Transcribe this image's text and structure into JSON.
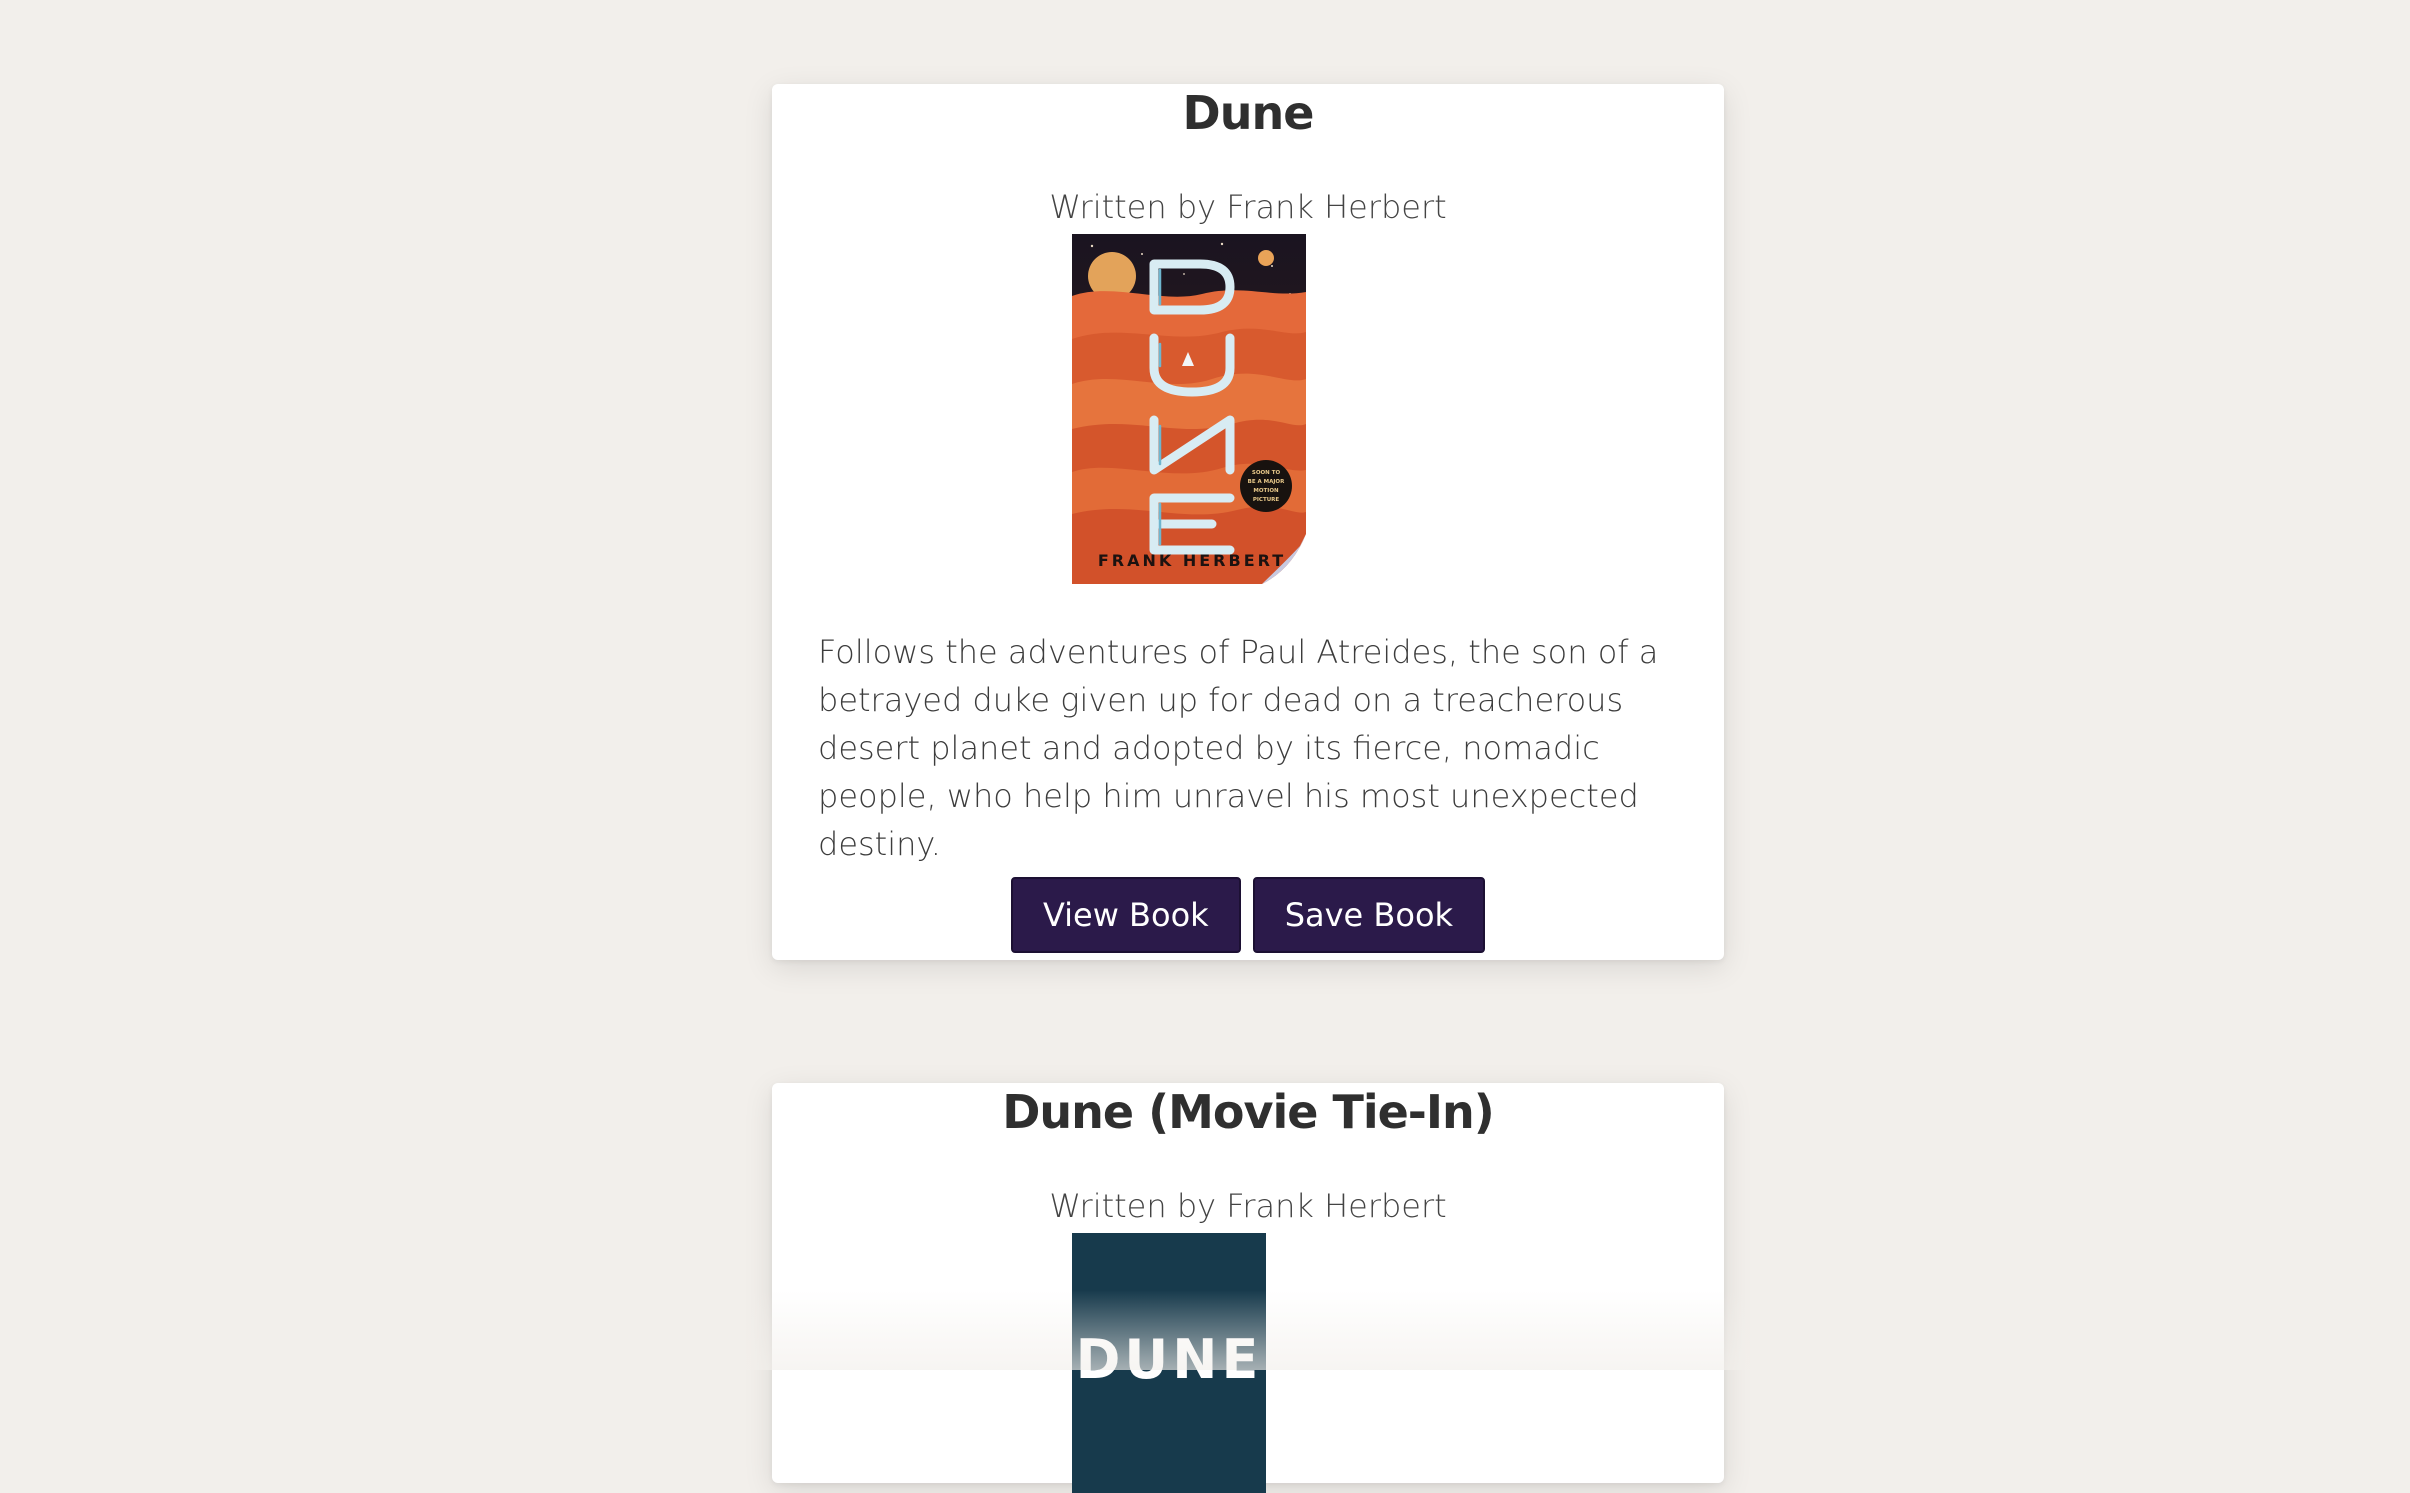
{
  "books": [
    {
      "title": "Dune",
      "author_line": "Written by Frank Herbert",
      "cover": {
        "title_text": "DUNE",
        "author_text": "FRANK HERBERT",
        "badge_lines": [
          "SOON TO",
          "BE A MAJOR",
          "MOTION",
          "PICTURE"
        ]
      },
      "description": "Follows the adventures of Paul Atreides, the son of a betrayed duke given up for dead on a treacherous desert planet and adopted by its fierce, nomadic people, who help him unravel his most unexpected destiny.",
      "view_label": "View Book",
      "save_label": "Save Book"
    },
    {
      "title": "Dune (Movie Tie-In)",
      "author_line": "Written by Frank Herbert",
      "cover": {
        "title_text": "DUNE"
      }
    }
  ],
  "colors": {
    "background": "#f2efeb",
    "card": "#ffffff",
    "button": "#2b1a4a",
    "button_text": "#ffffff",
    "tie_in_cover": "#173a4c"
  }
}
